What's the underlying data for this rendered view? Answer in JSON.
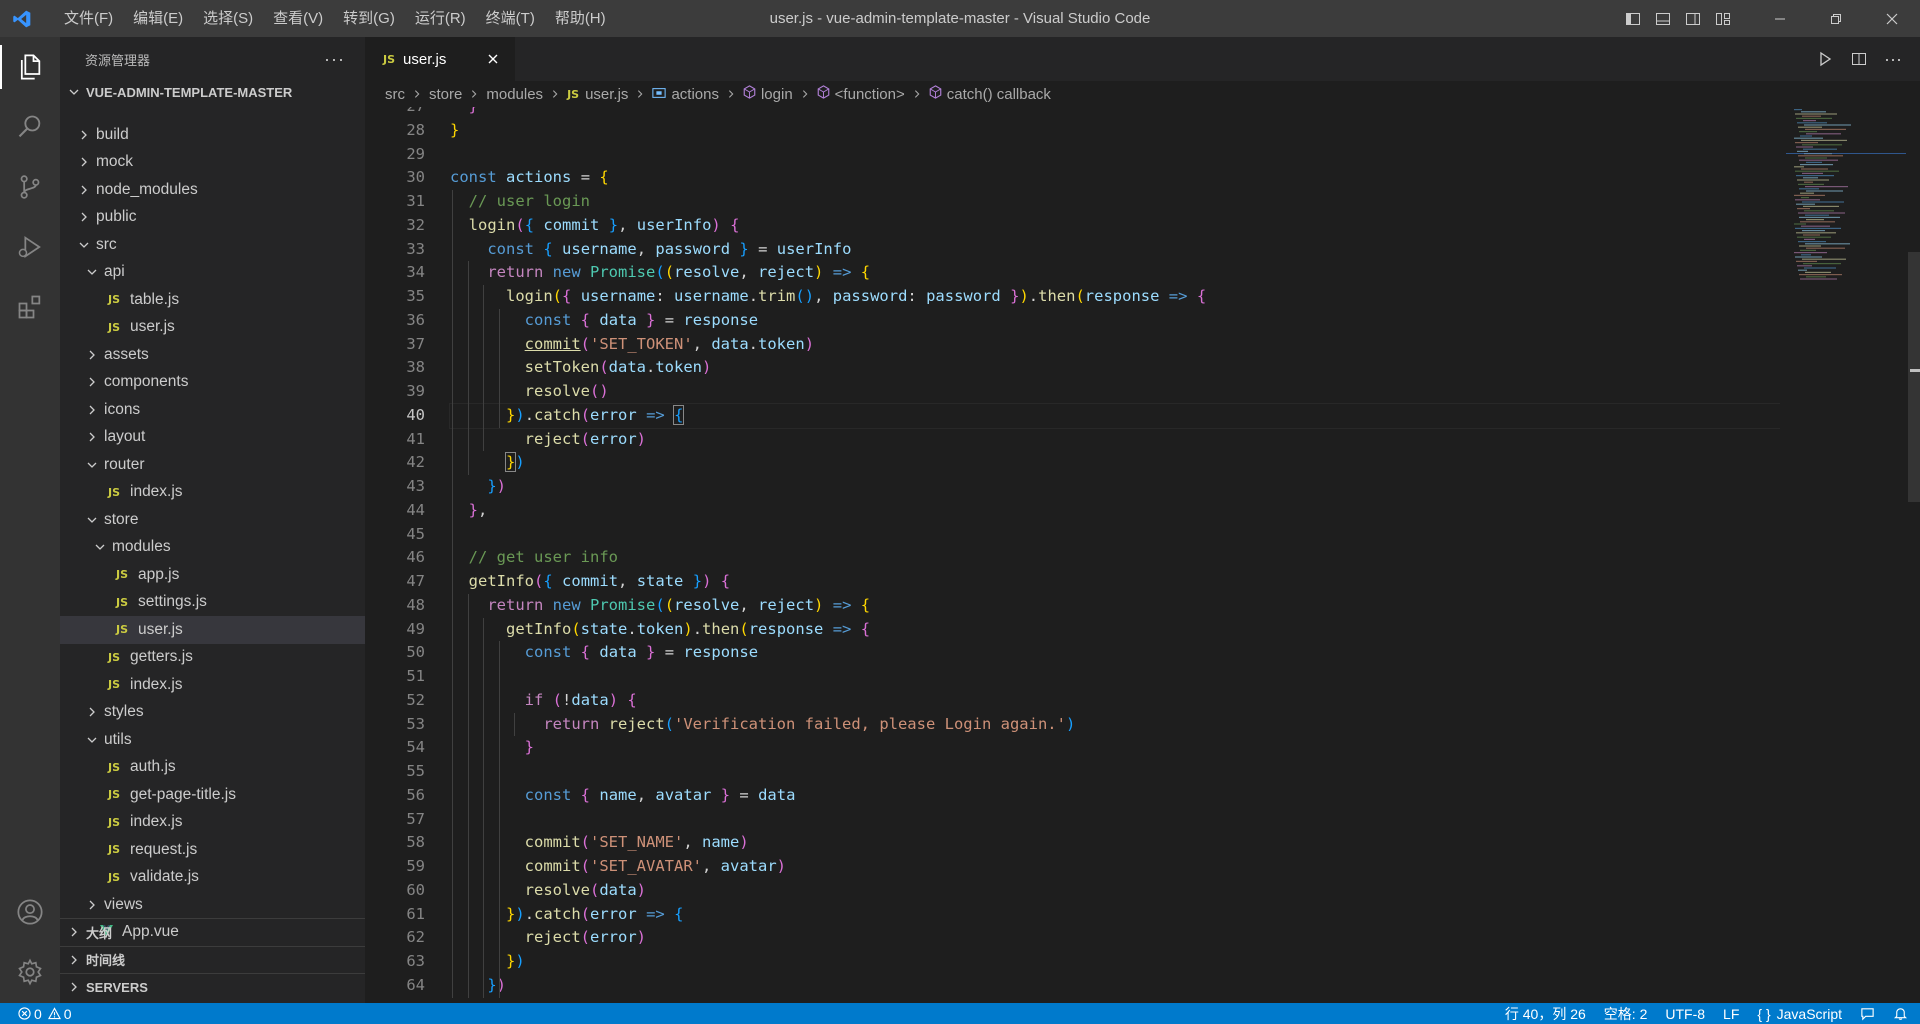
{
  "titlebar": {
    "menus": [
      "文件(F)",
      "编辑(E)",
      "选择(S)",
      "查看(V)",
      "转到(G)",
      "运行(R)",
      "终端(T)",
      "帮助(H)"
    ],
    "title": "user.js - vue-admin-template-master - Visual Studio Code"
  },
  "sidebar": {
    "header": "资源管理器",
    "root": "VUE-ADMIN-TEMPLATE-MASTER",
    "tree": [
      {
        "label": "build",
        "type": "folder",
        "depth": 0,
        "open": false
      },
      {
        "label": "mock",
        "type": "folder",
        "depth": 0,
        "open": false
      },
      {
        "label": "node_modules",
        "type": "folder",
        "depth": 0,
        "open": false
      },
      {
        "label": "public",
        "type": "folder",
        "depth": 0,
        "open": false
      },
      {
        "label": "src",
        "type": "folder",
        "depth": 0,
        "open": true
      },
      {
        "label": "api",
        "type": "folder",
        "depth": 1,
        "open": true
      },
      {
        "label": "table.js",
        "type": "js",
        "depth": 2
      },
      {
        "label": "user.js",
        "type": "js",
        "depth": 2
      },
      {
        "label": "assets",
        "type": "folder",
        "depth": 1,
        "open": false
      },
      {
        "label": "components",
        "type": "folder",
        "depth": 1,
        "open": false
      },
      {
        "label": "icons",
        "type": "folder",
        "depth": 1,
        "open": false
      },
      {
        "label": "layout",
        "type": "folder",
        "depth": 1,
        "open": false
      },
      {
        "label": "router",
        "type": "folder",
        "depth": 1,
        "open": true
      },
      {
        "label": "index.js",
        "type": "js",
        "depth": 2
      },
      {
        "label": "store",
        "type": "folder",
        "depth": 1,
        "open": true
      },
      {
        "label": "modules",
        "type": "folder",
        "depth": 2,
        "open": true
      },
      {
        "label": "app.js",
        "type": "js",
        "depth": 3
      },
      {
        "label": "settings.js",
        "type": "js",
        "depth": 3
      },
      {
        "label": "user.js",
        "type": "js",
        "depth": 3,
        "selected": true
      },
      {
        "label": "getters.js",
        "type": "js",
        "depth": 2
      },
      {
        "label": "index.js",
        "type": "js",
        "depth": 2
      },
      {
        "label": "styles",
        "type": "folder",
        "depth": 1,
        "open": false
      },
      {
        "label": "utils",
        "type": "folder",
        "depth": 1,
        "open": true
      },
      {
        "label": "auth.js",
        "type": "js",
        "depth": 2
      },
      {
        "label": "get-page-title.js",
        "type": "js",
        "depth": 2
      },
      {
        "label": "index.js",
        "type": "js",
        "depth": 2
      },
      {
        "label": "request.js",
        "type": "js",
        "depth": 2
      },
      {
        "label": "validate.js",
        "type": "js",
        "depth": 2
      },
      {
        "label": "views",
        "type": "folder",
        "depth": 1,
        "open": false
      },
      {
        "label": "App.vue",
        "type": "vue",
        "depth": 1
      }
    ],
    "panes": [
      "大纲",
      "时间线",
      "SERVERS"
    ]
  },
  "editor": {
    "tab": {
      "label": "user.js",
      "icon": "JS"
    },
    "breadcrumb": [
      "src",
      "store",
      "modules",
      "user.js",
      "actions",
      "login",
      "<function>",
      "catch() callback"
    ],
    "current_line": 40,
    "first_line": 27,
    "lines": [
      "  }",
      "}",
      "",
      "const actions = {",
      "  // user login",
      "  login({ commit }, userInfo) {",
      "    const { username, password } = userInfo",
      "    return new Promise((resolve, reject) => {",
      "      login({ username: username.trim(), password: password }).then(response => {",
      "        const { data } = response",
      "        commit('SET_TOKEN', data.token)",
      "        setToken(data.token)",
      "        resolve()",
      "      }).catch(error => {",
      "        reject(error)",
      "      })",
      "    })",
      "  },",
      "",
      "  // get user info",
      "  getInfo({ commit, state }) {",
      "    return new Promise((resolve, reject) => {",
      "      getInfo(state.token).then(response => {",
      "        const { data } = response",
      "",
      "        if (!data) {",
      "          return reject('Verification failed, please Login again.')",
      "        }",
      "",
      "        const { name, avatar } = data",
      "",
      "        commit('SET_NAME', name)",
      "        commit('SET_AVATAR', avatar)",
      "        resolve(data)",
      "      }).catch(error => {",
      "        reject(error)",
      "      })",
      "    })"
    ]
  },
  "statusbar": {
    "errors": "0",
    "warnings": "0",
    "position": "行 40，列 26",
    "spaces": "空格: 2",
    "encoding": "UTF-8",
    "eol": "LF",
    "language": "JavaScript",
    "language_prefix": "{ }"
  },
  "colors": {
    "accent": "#007acc",
    "titlebar": "#3c3c3c",
    "activitybar": "#333333",
    "sidebar": "#252526",
    "editor": "#1e1e1e"
  }
}
